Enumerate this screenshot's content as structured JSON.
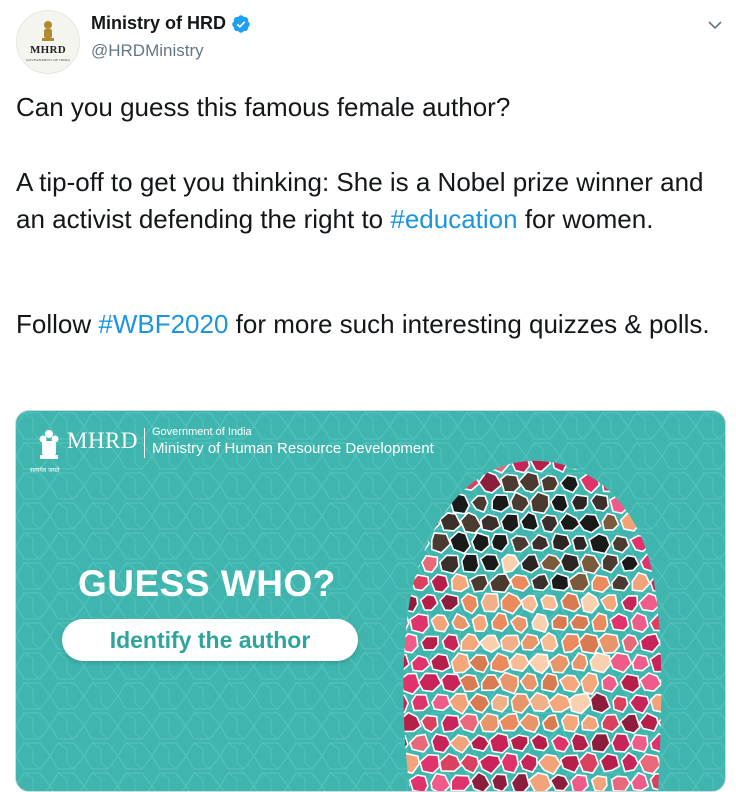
{
  "tweet": {
    "author": {
      "display_name": "Ministry of HRD",
      "handle": "@HRDMinistry",
      "verified": true,
      "avatar_text": "MHRD",
      "avatar_subtext": "GOVERNMENT OF INDIA"
    },
    "text": {
      "line1": "Can you guess this famous female author?",
      "para2_before": "A tip-off to get you thinking: She is a Nobel prize winner and an activist defending the right to ",
      "para2_hashtag": "#education",
      "para2_after": " for women.",
      "para3_before": "Follow ",
      "para3_hashtag": "#WBF2020",
      "para3_after": " for more such interesting quizzes & polls."
    },
    "media": {
      "logo_word": "MHRD",
      "emblem_text": "सत्यमेव जयते",
      "gov_line": "Government of India",
      "ministry_line": "Ministry of Human Resource Development",
      "headline": "GUESS WHO?",
      "pill_label": "Identify the author"
    }
  },
  "colors": {
    "link": "#1b95e0",
    "verified": "#1da1f2",
    "media_bg": "#3fb5ae",
    "pill_text": "#2da59c"
  },
  "icons": {
    "verified": "verified-badge-icon",
    "caret": "chevron-down-icon",
    "emblem": "ashoka-emblem-icon"
  }
}
